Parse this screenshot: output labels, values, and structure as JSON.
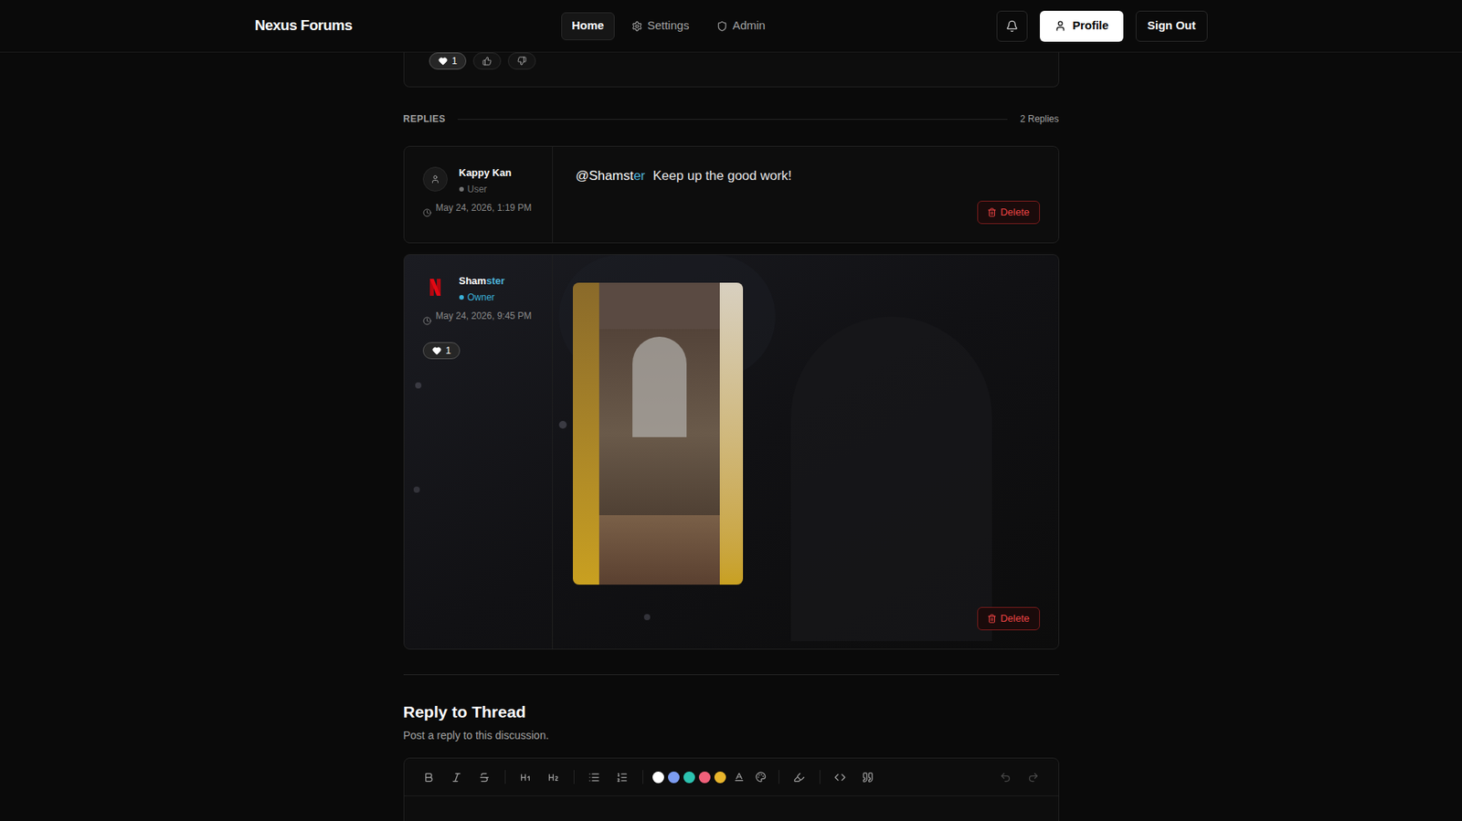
{
  "header": {
    "logo": "Nexus Forums",
    "nav": [
      {
        "label": "Home",
        "selected": true
      },
      {
        "label": "Settings",
        "selected": false
      },
      {
        "label": "Admin",
        "selected": false
      }
    ],
    "profile": "Profile",
    "sign_out": "Sign Out"
  },
  "post": {
    "reactions": [
      {
        "kind": "heart",
        "count": "1",
        "active": true
      },
      {
        "kind": "like",
        "count": "",
        "active": false
      },
      {
        "kind": "dislike",
        "count": "",
        "active": false
      }
    ]
  },
  "replies_section": {
    "label": "REPLIES",
    "count": "2 Replies"
  },
  "replies": [
    {
      "author": [
        {
          "text": "Kappy Kan",
          "highlight": false
        }
      ],
      "avatar": "default",
      "role": "User",
      "role_color": "#737373",
      "time": "May 24, 2026, 1:19 PM",
      "reactions": [],
      "content": {
        "kind": "text",
        "mention": [
          {
            "text": "@Shamst",
            "highlight": false
          },
          {
            "text": "er",
            "highlight": true
          }
        ],
        "text": "Keep up the good work!"
      },
      "has_background": false,
      "delete": "Delete"
    },
    {
      "author": [
        {
          "text": "Sham",
          "highlight": false
        },
        {
          "text": "ster",
          "highlight": true
        }
      ],
      "avatar": "logo",
      "role": "Owner",
      "role_color": "#3ab0d8",
      "time": "May 24, 2026, 9:45 PM",
      "reactions": [
        {
          "kind": "heart",
          "count": "1",
          "active": true
        }
      ],
      "content": {
        "kind": "image",
        "mention": [],
        "text": ""
      },
      "has_background": true,
      "delete": "Delete"
    }
  ],
  "composer": {
    "title": "Reply to Thread",
    "subtitle": "Post a reply to this discussion.",
    "colors": [
      "#ffffff",
      "#7c9cf0",
      "#2cc2b0",
      "#f0607a",
      "#e8b52c"
    ]
  }
}
